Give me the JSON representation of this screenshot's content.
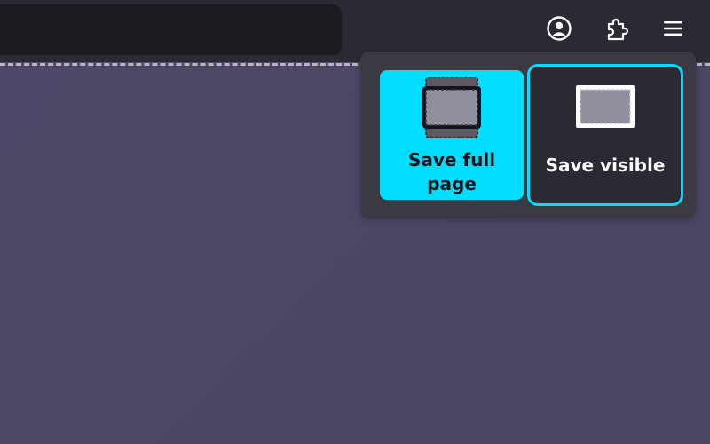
{
  "toolbar": {
    "icons": [
      "account-icon",
      "extensions-icon",
      "menu-icon"
    ]
  },
  "screenshot_panel": {
    "options": [
      {
        "icon": "full-page-icon",
        "label": "Save full page",
        "selected": true
      },
      {
        "icon": "visible-area-icon",
        "label": "Save visible",
        "focused": true
      }
    ]
  },
  "colors": {
    "accent": "#00ddff",
    "toolbar_bg": "#2b2a33",
    "panel_bg": "#3b3a42",
    "content_bg": "#4c4665"
  }
}
